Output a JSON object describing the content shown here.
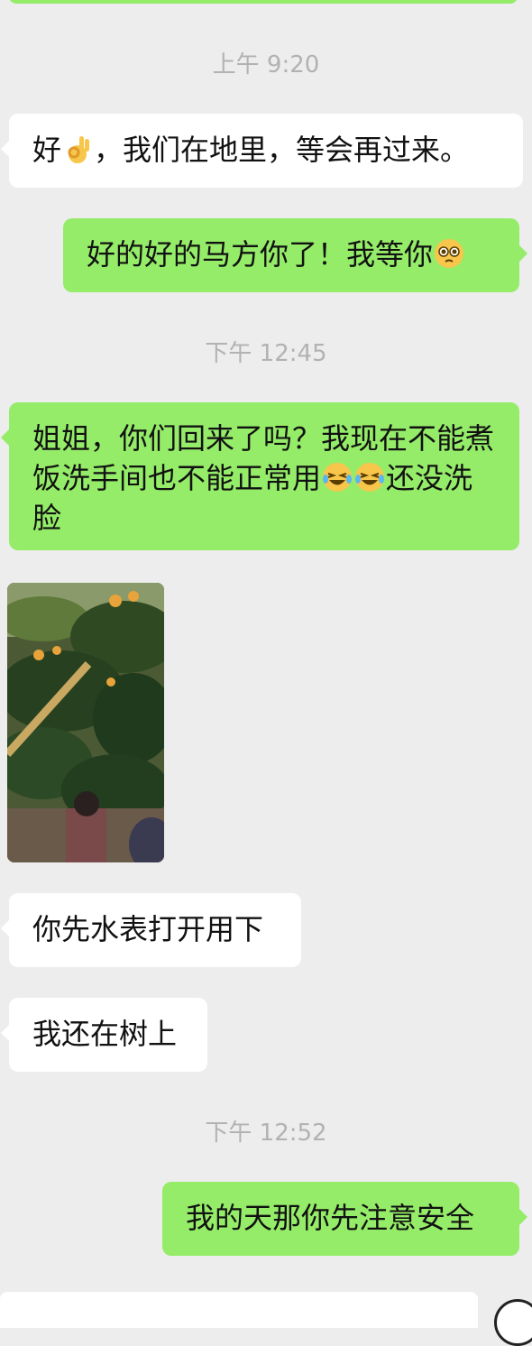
{
  "timestamps": [
    "上午 9:20",
    "下午 12:45",
    "下午 12:52"
  ],
  "messages": {
    "m1": "好",
    "m1b": "，我们在地里，等会再过来。",
    "m2": "好的好的马方你了！我等你",
    "m3": "姐姐，你们回来了吗？我现在不能煮饭洗手间也不能正常用",
    "m3b": "还没洗脸",
    "m4": "你先水表打开用下",
    "m5": "我还在树上",
    "m6": "我的天那你先注意安全"
  },
  "icons": {
    "ok": "ok-hand-emoji",
    "pleading": "pleading-face-emoji",
    "laugh": "laughing-crying-emoji",
    "photo": "loquat-tree-photo"
  },
  "colors": {
    "background": "#ededed",
    "outgoing": "#95ec69",
    "incoming": "#ffffff",
    "timestamp": "#b2b2b2"
  }
}
